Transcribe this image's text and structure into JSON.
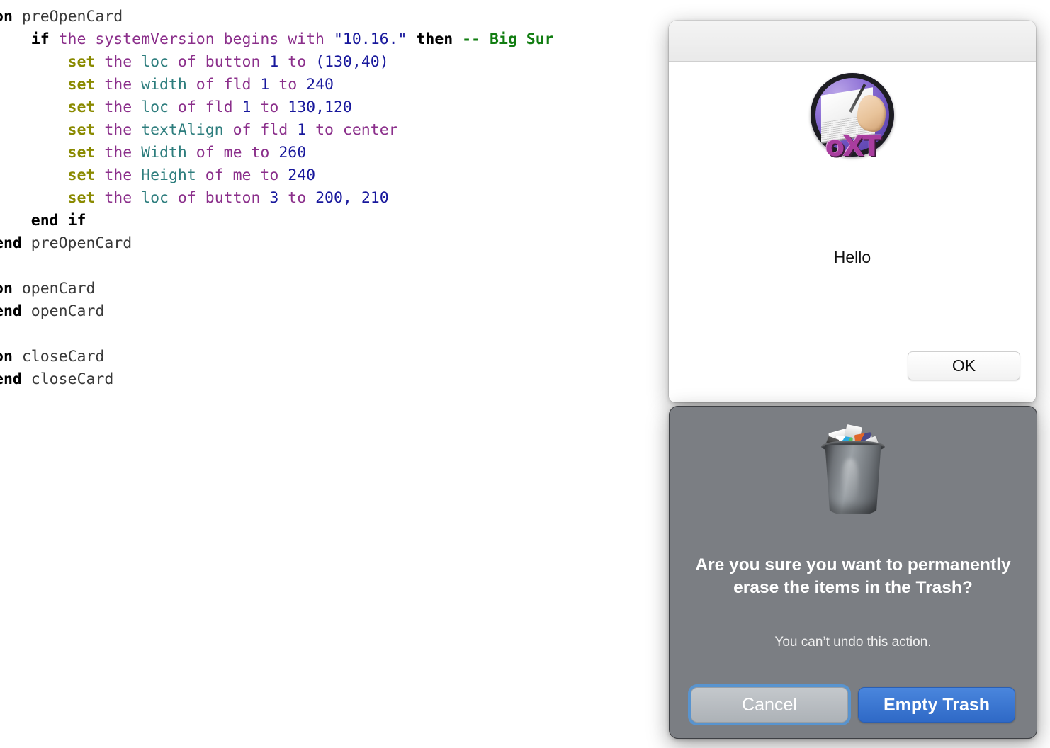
{
  "code_editor": {
    "language": "HyperTalk",
    "lines": [
      [
        {
          "t": "on ",
          "c": "kw"
        },
        {
          "t": "preOpenCard",
          "c": "hdl"
        }
      ],
      [
        {
          "t": "    if ",
          "c": "kw"
        },
        {
          "t": "the systemVersion begins with ",
          "c": "art"
        },
        {
          "t": "\"10.16.\"",
          "c": "str"
        },
        {
          "t": " then ",
          "c": "kw"
        },
        {
          "t": "-- Big Sur",
          "c": "com"
        }
      ],
      [
        {
          "t": "        set ",
          "c": "cmd"
        },
        {
          "t": "the ",
          "c": "art"
        },
        {
          "t": "loc",
          "c": "prop"
        },
        {
          "t": " of button ",
          "c": "art"
        },
        {
          "t": "1",
          "c": "num"
        },
        {
          "t": " to ",
          "c": "art"
        },
        {
          "t": "(130,40)",
          "c": "num"
        }
      ],
      [
        {
          "t": "        set ",
          "c": "cmd"
        },
        {
          "t": "the ",
          "c": "art"
        },
        {
          "t": "width",
          "c": "prop"
        },
        {
          "t": " of fld ",
          "c": "art"
        },
        {
          "t": "1",
          "c": "num"
        },
        {
          "t": " to ",
          "c": "art"
        },
        {
          "t": "240",
          "c": "num"
        }
      ],
      [
        {
          "t": "        set ",
          "c": "cmd"
        },
        {
          "t": "the ",
          "c": "art"
        },
        {
          "t": "loc",
          "c": "prop"
        },
        {
          "t": " of fld ",
          "c": "art"
        },
        {
          "t": "1",
          "c": "num"
        },
        {
          "t": " to ",
          "c": "art"
        },
        {
          "t": "130,120",
          "c": "num"
        }
      ],
      [
        {
          "t": "        set ",
          "c": "cmd"
        },
        {
          "t": "the ",
          "c": "art"
        },
        {
          "t": "textAlign",
          "c": "prop"
        },
        {
          "t": " of fld ",
          "c": "art"
        },
        {
          "t": "1",
          "c": "num"
        },
        {
          "t": " to center",
          "c": "art"
        }
      ],
      [
        {
          "t": "        set ",
          "c": "cmd"
        },
        {
          "t": "the ",
          "c": "art"
        },
        {
          "t": "Width",
          "c": "prop"
        },
        {
          "t": " of me to ",
          "c": "art"
        },
        {
          "t": "260",
          "c": "num"
        }
      ],
      [
        {
          "t": "        set ",
          "c": "cmd"
        },
        {
          "t": "the ",
          "c": "art"
        },
        {
          "t": "Height",
          "c": "prop"
        },
        {
          "t": " of me to ",
          "c": "art"
        },
        {
          "t": "240",
          "c": "num"
        }
      ],
      [
        {
          "t": "        set ",
          "c": "cmd"
        },
        {
          "t": "the ",
          "c": "art"
        },
        {
          "t": "loc",
          "c": "prop"
        },
        {
          "t": " of button ",
          "c": "art"
        },
        {
          "t": "3",
          "c": "num"
        },
        {
          "t": " to ",
          "c": "art"
        },
        {
          "t": "200, 210",
          "c": "num"
        }
      ],
      [
        {
          "t": "    end if",
          "c": "kw"
        }
      ],
      [
        {
          "t": "end ",
          "c": "kw"
        },
        {
          "t": "preOpenCard",
          "c": "hdl"
        }
      ],
      [],
      [
        {
          "t": "on ",
          "c": "kw"
        },
        {
          "t": "openCard",
          "c": "hdl"
        }
      ],
      [
        {
          "t": "end ",
          "c": "kw"
        },
        {
          "t": "openCard",
          "c": "hdl"
        }
      ],
      [],
      [
        {
          "t": "on ",
          "c": "kw"
        },
        {
          "t": "closeCard",
          "c": "hdl"
        }
      ],
      [
        {
          "t": "end ",
          "c": "kw"
        },
        {
          "t": "closeCard",
          "c": "hdl"
        }
      ]
    ],
    "syntax_colors": {
      "keyword": "#000000",
      "command": "#8a8a00",
      "article": "#8b2f8b",
      "property": "#2d7d7d",
      "number": "#18189c",
      "string": "#18189c",
      "comment": "#117d11",
      "handler_name": "#3a3a3a"
    }
  },
  "oxt_window": {
    "titlebar_title": "",
    "logo_wordmark": "oXT",
    "logo_icon": "oxt-app-icon",
    "greeting": "Hello",
    "ok_label": "OK"
  },
  "trash_dialog": {
    "icon": "full-trash-icon",
    "headline": "Are you sure you want to permanently erase the items in the Trash?",
    "subtext": "You can’t undo this action.",
    "cancel_label": "Cancel",
    "confirm_label": "Empty Trash",
    "colors": {
      "dialog_background": "#7b7e83",
      "confirm_button": "#3a76d0",
      "cancel_button": "#b8bcc0",
      "focus_ring": "#5696d6"
    }
  }
}
